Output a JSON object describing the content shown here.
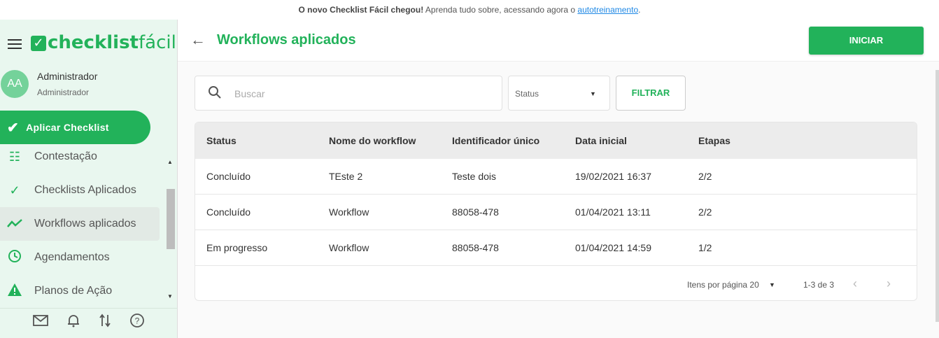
{
  "banner": {
    "bold": "O novo Checklist Fácil chegou!",
    "text": " Aprenda tudo sobre, acessando agora o ",
    "link": "autotreinamento",
    "end": "."
  },
  "sidebar": {
    "logo_bold": "checklist",
    "logo_light": "fácil",
    "avatar_initials": "AA",
    "user_name": "Administrador",
    "user_role": "Administrador",
    "apply_label": "Aplicar Checklist",
    "items": [
      {
        "label": "Contestação",
        "icon": "list-icon"
      },
      {
        "label": "Checklists Aplicados",
        "icon": "check-icon"
      },
      {
        "label": "Workflows aplicados",
        "icon": "trend-icon"
      },
      {
        "label": "Agendamentos",
        "icon": "clock-icon"
      },
      {
        "label": "Planos de Ação",
        "icon": "warning-icon"
      }
    ]
  },
  "header": {
    "title": "Workflows aplicados",
    "start_label": "INICIAR"
  },
  "filters": {
    "search_placeholder": "Buscar",
    "status_label": "Status",
    "filter_label": "FILTRAR"
  },
  "table": {
    "columns": [
      "Status",
      "Nome do workflow",
      "Identificador único",
      "Data inicial",
      "Etapas"
    ],
    "rows": [
      [
        "Concluído",
        "TEste 2",
        "Teste dois",
        "19/02/2021 16:37",
        "2/2"
      ],
      [
        "Concluído",
        "Workflow",
        "88058-478",
        "01/04/2021 13:11",
        "2/2"
      ],
      [
        "Em progresso",
        "Workflow",
        "88058-478",
        "01/04/2021 14:59",
        "1/2"
      ]
    ]
  },
  "pager": {
    "items_per_page": "Itens por página 20",
    "range": "1-3 de 3"
  },
  "colors": {
    "brand": "#22b25a",
    "sidebar_bg": "#e9f7ef"
  }
}
